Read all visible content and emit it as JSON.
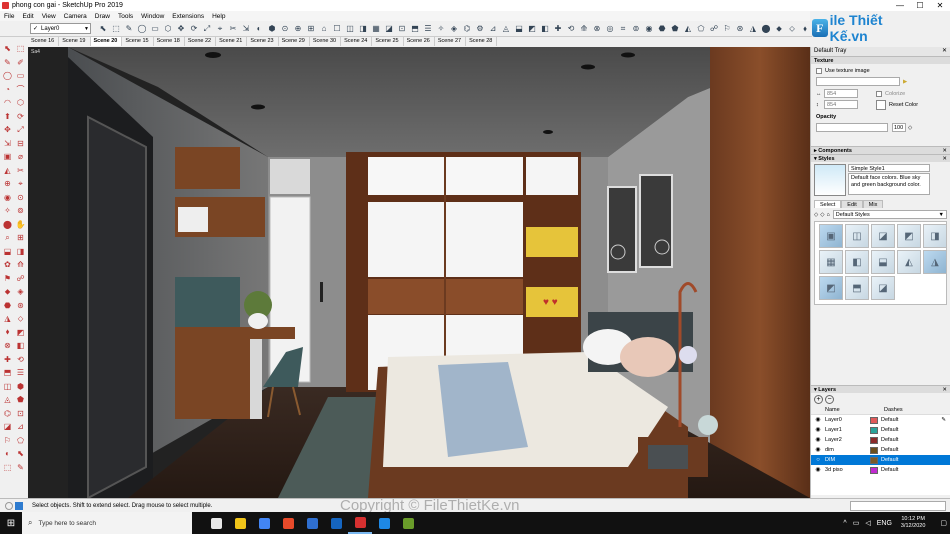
{
  "window": {
    "title": "phong con gai - SketchUp Pro 2019",
    "controls": [
      "—",
      "☐",
      "✕"
    ]
  },
  "menu": [
    "File",
    "Edit",
    "View",
    "Camera",
    "Draw",
    "Tools",
    "Window",
    "Extensions",
    "Help"
  ],
  "toolbar": {
    "layer_select_value": "Layer0",
    "layer_check": "✓"
  },
  "scenes": [
    "Scene 16",
    "Scene 19",
    "Scene 20",
    "Scene 15",
    "Scene 18",
    "Scene 22",
    "Scene 21",
    "Scene 23",
    "Scene 29",
    "Scene 30",
    "Scene 24",
    "Scene 25",
    "Scene 26",
    "Scene 27",
    "Scene 28"
  ],
  "active_scene_index": 2,
  "viewport": {
    "label": "Sa4"
  },
  "logo": {
    "mark": "F",
    "name": "ile Thiết Kế.vn"
  },
  "tray": {
    "title": "Default Tray",
    "close": "✕",
    "texture": {
      "heading": "Texture",
      "use_texture_image": "Use texture image",
      "width_value": "854",
      "height_value": "854",
      "colorize": "Colorize",
      "reset_color": "Reset Color",
      "opacity_label": "Opacity",
      "opacity_value": "100"
    },
    "components_heading": "Components",
    "styles": {
      "heading": "Styles",
      "style_name": "Simple Style1",
      "style_description": "Default face colors. Blue sky and green background color.",
      "tabs": [
        "Select",
        "Edit",
        "Mix"
      ],
      "active_tab": 0,
      "collection": "Default Styles"
    },
    "layers": {
      "heading": "Layers",
      "col_name": "Name",
      "col_dashes": "Dashes",
      "rows": [
        {
          "name": "Layer0",
          "color": "#e05a5a",
          "dashes": "Default",
          "selected": false
        },
        {
          "name": "Layer1",
          "color": "#2aa39a",
          "dashes": "Default",
          "selected": false
        },
        {
          "name": "Layer2",
          "color": "#8a2a2a",
          "dashes": "Default",
          "selected": false
        },
        {
          "name": "dim",
          "color": "#6b4f1e",
          "dashes": "Default",
          "selected": false
        },
        {
          "name": "DIM",
          "color": "#7a5a2a",
          "dashes": "Default",
          "selected": true
        },
        {
          "name": "3d piso",
          "color": "#c02ad0",
          "dashes": "Default",
          "selected": false
        }
      ]
    }
  },
  "status": {
    "message": "Select objects. Shift to extend select. Drag mouse to select multiple."
  },
  "watermark": "Copyright © FileThietKe.vn",
  "taskbar": {
    "search_placeholder": "Type here to search",
    "time": "10:12 PM",
    "date": "3/12/2020",
    "lang": "ENG",
    "app_colors": [
      "#e8e8e8",
      "#f0c419",
      "#4285f4",
      "#e84a2a",
      "#2f6fd0",
      "#1565c0",
      "#d63030",
      "#1e88e5",
      "#6a9c2a"
    ]
  }
}
